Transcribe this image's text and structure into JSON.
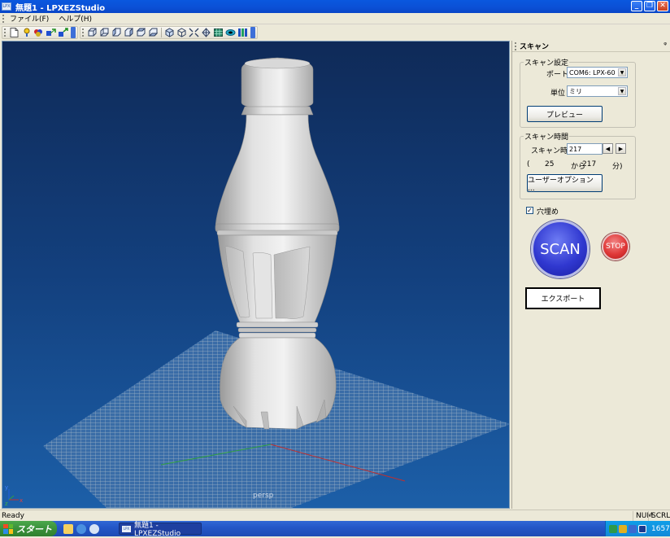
{
  "window": {
    "app_icon_text": "LPX",
    "title": "無題1 - LPXEZStudio",
    "buttons": [
      "minimize",
      "maximize",
      "close"
    ]
  },
  "menu": {
    "items": [
      {
        "label": "ファイル(F)"
      },
      {
        "label": "ヘルプ(H)"
      }
    ]
  },
  "toolbar": {
    "icons": [
      "new-file-icon",
      "help-icon",
      "colors-icon",
      "axes-icon",
      "axes-rotate-icon",
      "front-view-icon",
      "back-view-icon",
      "left-view-icon",
      "right-view-icon",
      "top-view-icon",
      "bottom-view-icon",
      "iso-view-icon",
      "wireframe-icon",
      "fit-icon",
      "center-icon",
      "grid-icon",
      "shade-icon",
      "render-icon"
    ]
  },
  "viewport": {
    "label": "persp"
  },
  "panel": {
    "title": "スキャン",
    "pin_symbol": "ᵠ",
    "scan_settings": {
      "legend": "スキャン設定",
      "port_label": "ポート",
      "port_value": "COM6: LPX-60",
      "unit_label": "単位",
      "unit_value": "ミリ",
      "preview_label": "プレビュー"
    },
    "scan_time": {
      "legend": "スキャン時間",
      "time_label": "スキャン時間",
      "time_value": "217",
      "range_open": "(",
      "range_min": "25",
      "range_from": "から",
      "range_max": "217",
      "range_unit": "分)",
      "user_options_label": "ユーザーオプション ..."
    },
    "fill_holes": {
      "checked": true,
      "check_mark": "✓",
      "label": "穴埋め"
    },
    "scan_label": "SCAN",
    "stop_label": "STOP",
    "export_label": "エクスポート"
  },
  "statusbar": {
    "text": "Ready",
    "num": "NUM",
    "scrl": "SCRL"
  },
  "taskbar": {
    "start_label": "スタート",
    "task_icon_text": "LPX",
    "task_label": "無題1 - LPXEZStudio",
    "clock": "1657"
  }
}
